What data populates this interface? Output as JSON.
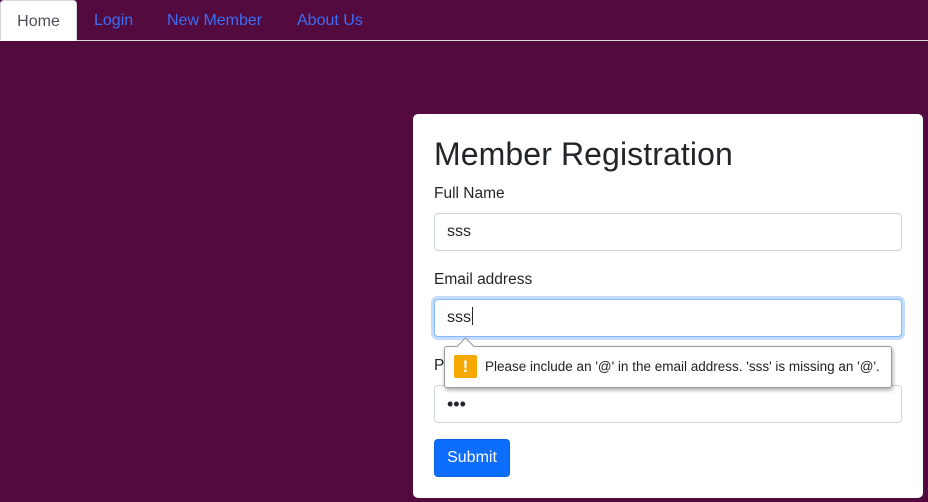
{
  "nav": {
    "tabs": [
      {
        "label": "Home",
        "active": true
      },
      {
        "label": "Login",
        "active": false
      },
      {
        "label": "New Member",
        "active": false
      },
      {
        "label": "About Us",
        "active": false
      }
    ]
  },
  "form": {
    "title": "Member Registration",
    "full_name": {
      "label": "Full Name",
      "value": "sss"
    },
    "email": {
      "label": "Email address",
      "value": "sss"
    },
    "password": {
      "label": "Pa",
      "value": "•••"
    },
    "submit_label": "Submit"
  },
  "validation": {
    "icon": "warning-icon",
    "icon_glyph": "!",
    "message": "Please include an '@' in the email address. 'sss' is missing an '@'."
  },
  "colors": {
    "background": "#520a3f",
    "link": "#3b6ef5",
    "primary_button": "#0d6efd",
    "warning": "#f6a800"
  }
}
